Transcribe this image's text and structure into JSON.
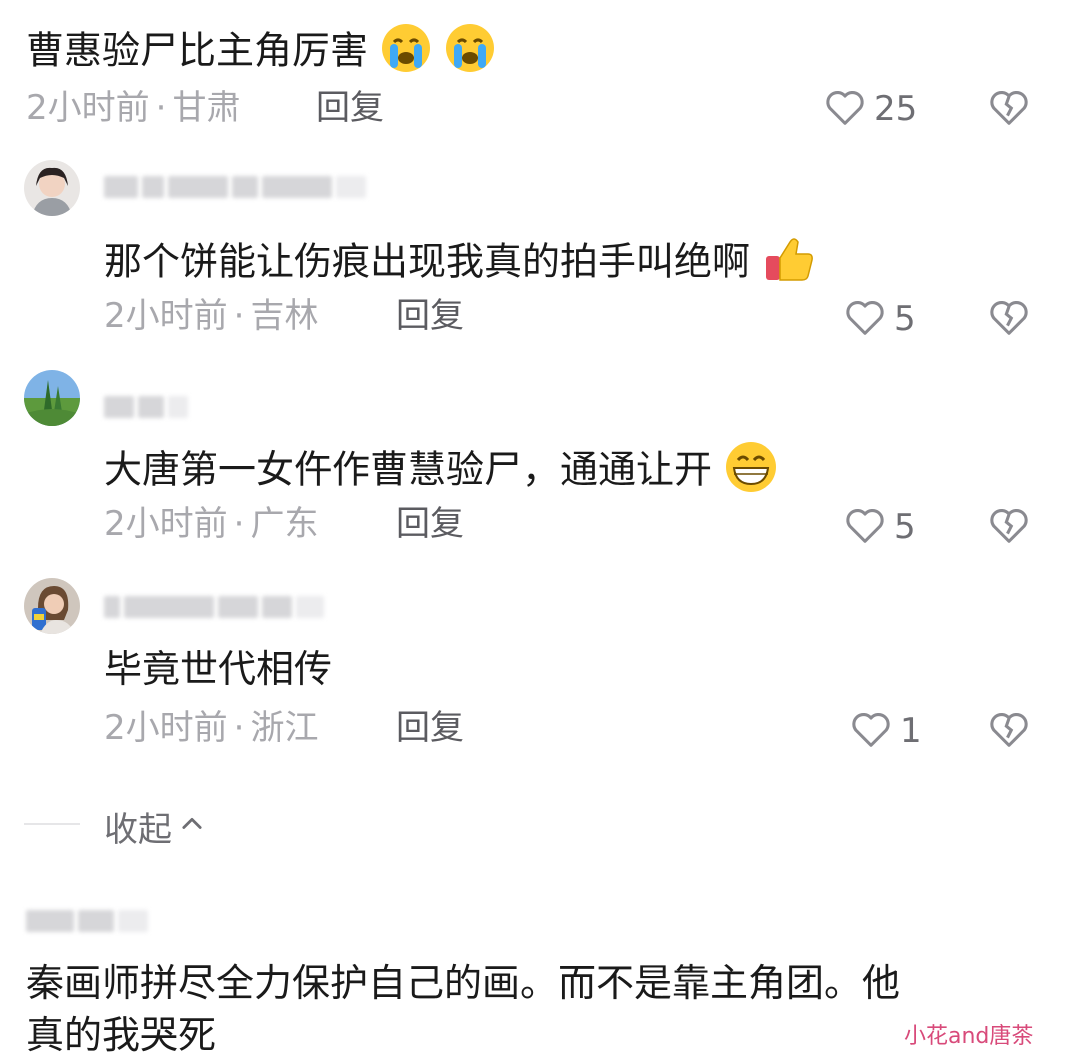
{
  "top_comment": {
    "text": "曹惠验尸比主角厉害",
    "emoji": [
      "crying-face",
      "crying-face"
    ],
    "time": "2小时前",
    "location": "甘肃",
    "reply_label": "回复",
    "likes": "25"
  },
  "replies": [
    {
      "text": "那个饼能让伤痕出现我真的拍手叫绝啊",
      "emoji": "thumbs-up",
      "time": "2小时前",
      "location": "吉林",
      "reply_label": "回复",
      "likes": "5"
    },
    {
      "text": "大唐第一女仵作曹慧验尸，通通让开",
      "emoji": "grinning-face",
      "time": "2小时前",
      "location": "广东",
      "reply_label": "回复",
      "likes": "5"
    },
    {
      "text": "毕竟世代相传",
      "emoji": "",
      "time": "2小时前",
      "location": "浙江",
      "reply_label": "回复",
      "likes": "1"
    }
  ],
  "collapse_label": "收起",
  "next_comment": {
    "line1": "秦画师拼尽全力保护自己的画。而不是靠主角团。他",
    "line2": "真的我哭死"
  },
  "watermark": "小花and唐茶",
  "colors": {
    "text": "#1a1a1a",
    "meta": "#a8a8ad",
    "watermark": "#d84a7a"
  }
}
